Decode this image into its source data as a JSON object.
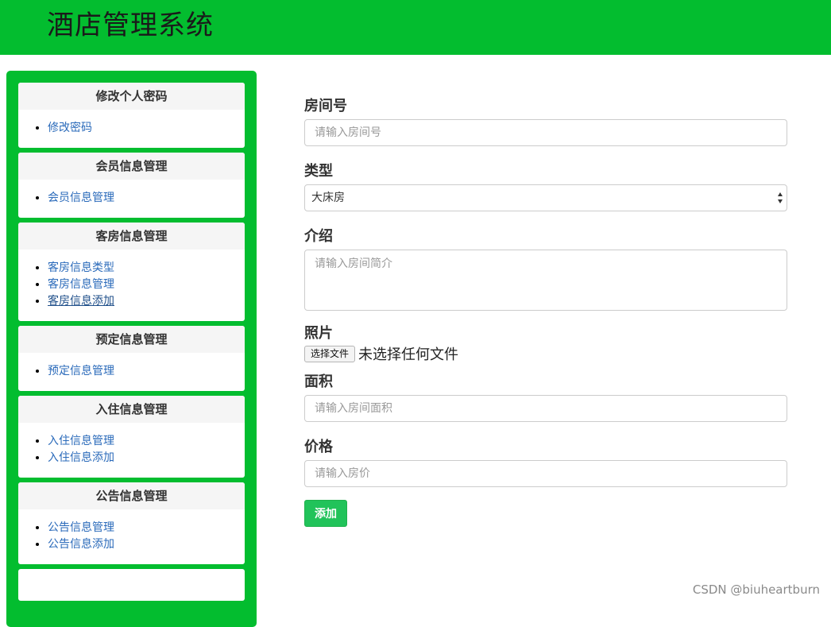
{
  "header": {
    "title": "酒店管理系统"
  },
  "sidebar": {
    "panels": [
      {
        "title": "修改个人密码",
        "items": [
          "修改密码"
        ]
      },
      {
        "title": "会员信息管理",
        "items": [
          "会员信息管理"
        ]
      },
      {
        "title": "客房信息管理",
        "items": [
          "客房信息类型",
          "客房信息管理",
          "客房信息添加"
        ]
      },
      {
        "title": "预定信息管理",
        "items": [
          "预定信息管理"
        ]
      },
      {
        "title": "入住信息管理",
        "items": [
          "入住信息管理",
          "入住信息添加"
        ]
      },
      {
        "title": "公告信息管理",
        "items": [
          "公告信息管理",
          "公告信息添加"
        ]
      }
    ]
  },
  "form": {
    "room_number": {
      "label": "房间号",
      "placeholder": "请输入房间号"
    },
    "type": {
      "label": "类型",
      "selected": "大床房"
    },
    "intro": {
      "label": "介绍",
      "placeholder": "请输入房间简介"
    },
    "photo": {
      "label": "照片",
      "button": "选择文件",
      "status": "未选择任何文件"
    },
    "area": {
      "label": "面积",
      "placeholder": "请输入房间面积"
    },
    "price": {
      "label": "价格",
      "placeholder": "请输入房价"
    },
    "submit_label": "添加"
  },
  "watermark": "CSDN @biuheartburn",
  "colors": {
    "header_bg": "#03bd2f",
    "link": "#2a6aba",
    "button_bg": "#21c35a"
  }
}
